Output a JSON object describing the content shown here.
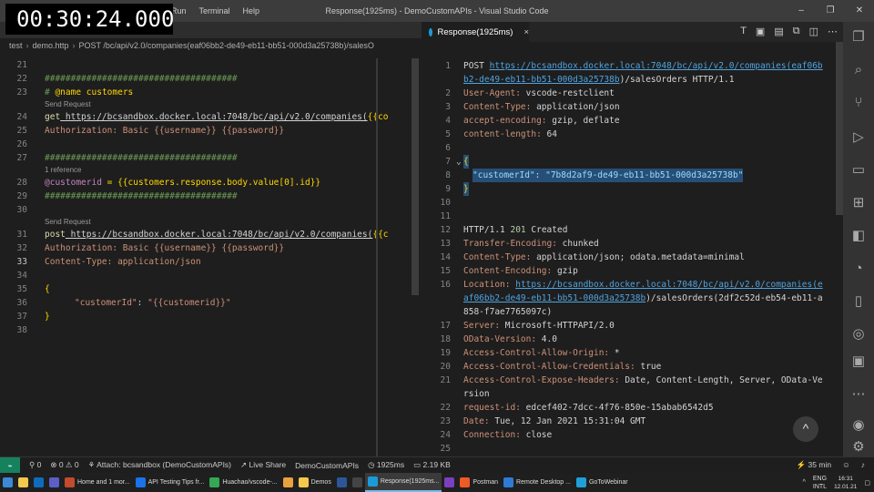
{
  "timer": "00:30:24.000",
  "titlebar": {
    "menu": [
      "Run",
      "Terminal",
      "Help"
    ],
    "title": "Response(1925ms) - DemoCustomAPIs - Visual Studio Code"
  },
  "left": {
    "breadcrumb": [
      "test",
      "demo.http",
      "POST /bc/api/v2.0/companies(eaf06bb2-de49-eb11-bb51-000d3a25738b)/salesO"
    ],
    "codelens": {
      "send1": "Send Request",
      "ref": "1 reference",
      "send2": "Send Request"
    },
    "lines": {
      "l21": "21",
      "l22": "22",
      "l23": "23",
      "l24": "24",
      "l25": "25",
      "l26": "26",
      "l27": "27",
      "l28": "28",
      "l29": "29",
      "l30": "30",
      "l31": "31",
      "l32": "32",
      "l33": "33",
      "l34": "34",
      "l35": "35",
      "l36": "36",
      "l37": "37",
      "l38": "38"
    },
    "code": {
      "c22": "#####################################",
      "c23_hash": "# ",
      "c23_name": "@name",
      "c23_rest": " customers",
      "c24_method": "get",
      "c24_url": " https://bcsandbox.docker.local:7048/bc/api/v2.0/companies(",
      "c24_var": "{{co",
      "c25_key": "Authorization:",
      "c25_val": " Basic {{username}} {{password}}",
      "c27": "#####################################",
      "c28_var": "@customerid",
      "c28_rest": " = {{customers.response.body.value[0].id}}",
      "c29": "#####################################",
      "c31_method": "post",
      "c31_url": " https://bcsandbox.docker.local:7048/bc/api/v2.0/companies(",
      "c31_var": "{{c",
      "c32_key": "Authorization:",
      "c32_val": " Basic {{username}} {{password}}",
      "c33_key": "Content-Type:",
      "c33_val": " application/json",
      "c35": "{",
      "c36_key": "\"customerId\"",
      "c36_colon": ": ",
      "c36_val": "\"{{customerid}}\"",
      "c37": "}"
    }
  },
  "right": {
    "tab_label": "Response(1925ms)",
    "tab_close": "×",
    "up_button": "^",
    "lines": {
      "n1": "1",
      "n2": "2",
      "n3": "3",
      "n4": "4",
      "n5": "5",
      "n6": "6",
      "n7": "7",
      "n8": "8",
      "n9": "9",
      "n10": "10",
      "n11": "11",
      "n12": "12",
      "n13": "13",
      "n14": "14",
      "n15": "15",
      "n16": "16",
      "n17": "17",
      "n18": "18",
      "n19": "19",
      "n20": "20",
      "n21": "21",
      "n22": "22",
      "n23": "23",
      "n24": "24",
      "n25": "25"
    },
    "code": {
      "r1_method": "POST ",
      "r1_url": "https://bcsandbox.docker.local:7048/bc/api/v2.0/companies(eaf06b",
      "r1b_url": "b2-de49-eb11-bb51-000d3a25738b",
      "r1b_rest": ")/salesOrders HTTP/1.1",
      "r2_key": "User-Agent:",
      "r2_val": " vscode-restclient",
      "r3_key": "Content-Type:",
      "r3_val": " application/json",
      "r4_key": "accept-encoding:",
      "r4_val": " gzip, deflate",
      "r5_key": "content-length:",
      "r5_val": " 64",
      "r7": "{",
      "r8_key": "\"customerId\"",
      "r8_colon": ": ",
      "r8_val": "\"7b8d2af9-de49-eb11-bb51-000d3a25738b\"",
      "r9": "}",
      "r12_pre": "HTTP/1.1 ",
      "r12_code": "201",
      "r12_post": " Created",
      "r13_key": "Transfer-Encoding:",
      "r13_val": " chunked",
      "r14_key": "Content-Type:",
      "r14_val": " application/json; odata.metadata=minimal",
      "r15_key": "Content-Encoding:",
      "r15_val": " gzip",
      "r16_key": "Location:",
      "r16_sp": " ",
      "r16_url": "https://bcsandbox.docker.local:7048/bc/api/v2.0/companies(e",
      "r16b_url": "af06bb2-de49-eb11-bb51-000d3a25738b",
      "r16b_rest": ")/salesOrders(2df2c52d-eb54-eb11-a",
      "r16c": "858-f7ae7765097c)",
      "r17_key": "Server:",
      "r17_val": " Microsoft-HTTPAPI/2.0",
      "r18_key": "OData-Version:",
      "r18_val": " 4.0",
      "r19_key": "Access-Control-Allow-Origin:",
      "r19_val": " *",
      "r20_key": "Access-Control-Allow-Credentials:",
      "r20_val": " true",
      "r21_key": "Access-Control-Expose-Headers:",
      "r21_val": " Date, Content-Length, Server, OData-Ve",
      "r21b": "rsion",
      "r22_key": "request-id:",
      "r22_val": " edcef402-7dcc-4f76-850e-15abab6542d5",
      "r23_key": "Date:",
      "r23_val": " Tue, 12 Jan 2021 15:31:04 GMT",
      "r24_key": "Connection:",
      "r24_val": " close"
    }
  },
  "statusbar": {
    "errors": "0",
    "warnings": "0",
    "sync": "0",
    "attach": "Attach: bcsandbox (DemoCustomAPIs)",
    "liveshare": "Live Share",
    "workspace": "DemoCustomAPIs",
    "time": "1925ms",
    "size": "2.19 KB",
    "duration": "35 min"
  },
  "taskbar": {
    "items": [
      {
        "label": "Home and 1 mor...",
        "color": "#c34a2c"
      },
      {
        "label": "API Testing Tips fr...",
        "color": "#1a73e8"
      },
      {
        "label": "Huachao/vscode-...",
        "color": "#34a853"
      },
      {
        "label": "",
        "color": "#e8a33c"
      },
      {
        "label": "Demos",
        "color": "#f2c94c"
      },
      {
        "label": "",
        "color": "#2b579a"
      },
      {
        "label": "",
        "color": "#444444"
      },
      {
        "label": "Response(1925ms...",
        "color": "#1a9bd7"
      },
      {
        "label": "",
        "color": "#7b3fbf"
      },
      {
        "label": "Postman",
        "color": "#ef5b25"
      },
      {
        "label": "Remote Desktop ...",
        "color": "#2e7bd6"
      },
      {
        "label": "GoToWebinar",
        "color": "#1fa0d8"
      }
    ],
    "lang": "ENG",
    "region": "INTL",
    "time": "16:31",
    "date": "12.01.21"
  }
}
